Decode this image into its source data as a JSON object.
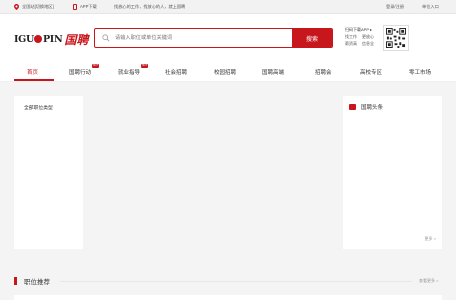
{
  "topbar": {
    "location": "全国站[切换地区]",
    "app": "APP下载",
    "slogan": "找放心的工作，找放心的人，就上国聘",
    "login": "登录/注册",
    "org": "单位入口"
  },
  "logo": {
    "en_left": "IGU",
    "en_right": "PIN",
    "cn": "国聘"
  },
  "search": {
    "placeholder": "请输入职位或单位关键词",
    "button": "搜索"
  },
  "app_download": {
    "title": "扫码下载APP ▸",
    "features": [
      "找工作",
      "更放心",
      "薪资高",
      "信息全"
    ]
  },
  "nav": {
    "items": [
      "首页",
      "国聘行动",
      "就业指导",
      "社会招聘",
      "校园招聘",
      "国聘高端",
      "招聘会",
      "高校专区",
      "零工市场"
    ],
    "hot_badge": "HOT"
  },
  "left_panel": {
    "label": "全部职位类型"
  },
  "right_panel": {
    "title": "国聘头条",
    "more": "更多 >"
  },
  "section": {
    "title": "职位推荐",
    "more": "查看更多 >"
  },
  "colors": {
    "brand": "#c8161d",
    "background": "#f4f4f4"
  }
}
